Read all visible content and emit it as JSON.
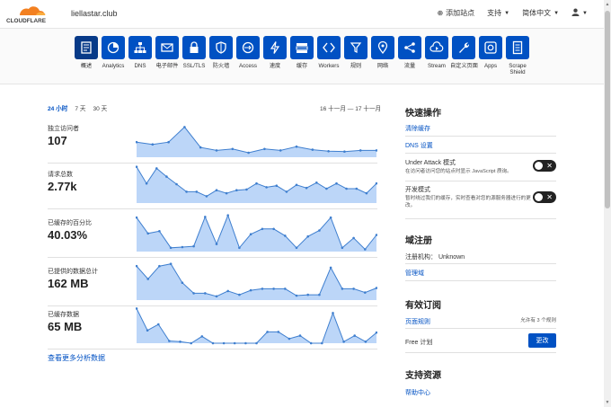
{
  "header": {
    "logo_text": "CLOUDFLARE",
    "domain": "liellastar.club",
    "add_site": "添加站点",
    "support": "支持",
    "language": "简体中文"
  },
  "nav": [
    {
      "label": "概述",
      "icon": "overview-icon",
      "active": true
    },
    {
      "label": "Analytics",
      "icon": "analytics-icon"
    },
    {
      "label": "DNS",
      "icon": "dns-icon"
    },
    {
      "label": "电子邮件",
      "icon": "email-icon"
    },
    {
      "label": "SSL/TLS",
      "icon": "lock-icon"
    },
    {
      "label": "防火墙",
      "icon": "shield-icon"
    },
    {
      "label": "Access",
      "icon": "access-icon"
    },
    {
      "label": "速度",
      "icon": "lightning-icon"
    },
    {
      "label": "缓存",
      "icon": "cache-icon"
    },
    {
      "label": "Workers",
      "icon": "workers-icon"
    },
    {
      "label": "规则",
      "icon": "rules-icon"
    },
    {
      "label": "网络",
      "icon": "location-icon"
    },
    {
      "label": "流量",
      "icon": "traffic-icon"
    },
    {
      "label": "Stream",
      "icon": "stream-icon"
    },
    {
      "label": "自定义页面",
      "icon": "wrench-icon"
    },
    {
      "label": "Apps",
      "icon": "apps-icon"
    },
    {
      "label": "Scrape Shield",
      "icon": "document-icon"
    }
  ],
  "timeframe": {
    "tabs": [
      "24 小时",
      "7 天",
      "30 天"
    ],
    "active": 0,
    "range": "16 十一月 — 17 十一月"
  },
  "metrics": [
    {
      "label": "独立访问者",
      "value": "107",
      "series": [
        40,
        34,
        40,
        80,
        26,
        18,
        22,
        12,
        22,
        18,
        28,
        20,
        16,
        15,
        18,
        18
      ]
    },
    {
      "label": "请求总数",
      "value": "2.77k",
      "series": [
        96,
        52,
        92,
        70,
        50,
        30,
        30,
        18,
        34,
        26,
        34,
        36,
        52,
        42,
        46,
        30,
        48,
        40,
        54,
        38,
        52,
        38,
        38,
        26,
        52
      ]
    },
    {
      "label": "已缓存的百分比",
      "value": "40.03%",
      "series": [
        90,
        48,
        54,
        10,
        12,
        14,
        92,
        20,
        96,
        10,
        46,
        60,
        60,
        42,
        10,
        40,
        56,
        90,
        10,
        36,
        6,
        44
      ]
    },
    {
      "label": "已提供的数据总计",
      "value": "162 MB",
      "series": [
        90,
        56,
        90,
        96,
        46,
        18,
        18,
        10,
        24,
        14,
        26,
        30,
        30,
        30,
        12,
        14,
        14,
        86,
        30,
        30,
        20,
        32
      ]
    },
    {
      "label": "已缓存数据",
      "value": "65 MB",
      "series": [
        92,
        34,
        50,
        6,
        4,
        0,
        18,
        0,
        0,
        0,
        0,
        0,
        30,
        30,
        12,
        20,
        0,
        0,
        80,
        4,
        20,
        4,
        28
      ]
    }
  ],
  "more_analytics": "查看更多分析数据",
  "quick_actions": {
    "title": "快速操作",
    "purge": "清除缓存",
    "dns_settings": "DNS 设置",
    "under_attack_title": "Under Attack 模式",
    "under_attack_desc": "在访问者访问您的站点时显示 JavaScript 质询。",
    "dev_mode_title": "开发模式",
    "dev_mode_desc": "暂时绕过我们的缓存，实时查看对您的源服务器进行的更改。"
  },
  "registration": {
    "title": "域注册",
    "registrar_label": "注册机构：",
    "registrar_value": "Unknown",
    "manage": "管理域"
  },
  "subscriptions": {
    "title": "有效订阅",
    "page_rules": "页面规则",
    "page_rules_info": "允许有 3 个规则",
    "plan": "Free 计划",
    "change": "更改"
  },
  "support_resources": {
    "title": "支持资源",
    "help_center": "帮助中心"
  },
  "colors": {
    "brand_blue": "#0051c3",
    "active_nav": "#073a88",
    "chart_fill": "#bcd6f8",
    "chart_line": "#3f7fcf",
    "cloudflare_orange": "#f38020"
  }
}
